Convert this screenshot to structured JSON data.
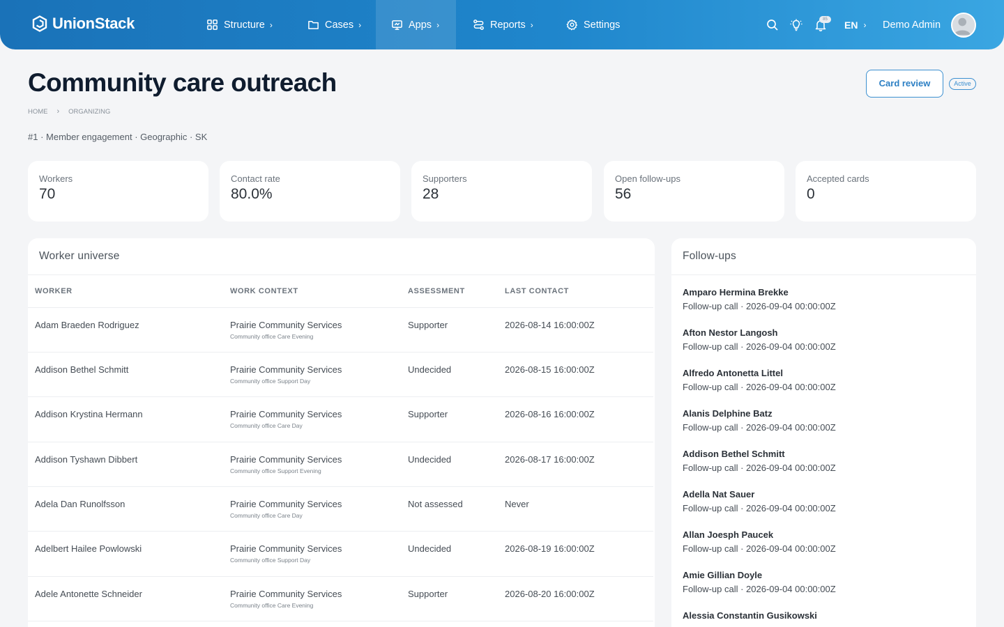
{
  "brand": {
    "name": "UnionStack"
  },
  "nav": {
    "items": [
      {
        "label": "Structure",
        "icon": "grid-icon"
      },
      {
        "label": "Cases",
        "icon": "folder-icon"
      },
      {
        "label": "Apps",
        "icon": "monitor-icon"
      },
      {
        "label": "Reports",
        "icon": "route-icon"
      },
      {
        "label": "Settings",
        "icon": "gear-icon"
      }
    ],
    "active": "Apps",
    "language": "EN",
    "notification_badge": "85",
    "user_name": "Demo Admin"
  },
  "header": {
    "title": "Community care outreach",
    "card_review_label": "Card review",
    "status": "Active",
    "breadcrumb": [
      "HOME",
      "ORGANIZING"
    ],
    "meta": "#1 · Member engagement · Geographic · SK"
  },
  "stats": [
    {
      "label": "Workers",
      "value": "70"
    },
    {
      "label": "Contact rate",
      "value": "80.0%"
    },
    {
      "label": "Supporters",
      "value": "28"
    },
    {
      "label": "Open follow-ups",
      "value": "56"
    },
    {
      "label": "Accepted cards",
      "value": "0"
    }
  ],
  "workers": {
    "title": "Worker universe",
    "columns": [
      "WORKER",
      "WORK CONTEXT",
      "ASSESSMENT",
      "LAST CONTACT"
    ],
    "rows": [
      {
        "worker": "Adam Braeden Rodriguez",
        "context": "Prairie Community Services",
        "sub": "Community office Care Evening",
        "assessment": "Supporter",
        "last_contact": "2026-08-14 16:00:00Z"
      },
      {
        "worker": "Addison Bethel Schmitt",
        "context": "Prairie Community Services",
        "sub": "Community office Support Day",
        "assessment": "Undecided",
        "last_contact": "2026-08-15 16:00:00Z"
      },
      {
        "worker": "Addison Krystina Hermann",
        "context": "Prairie Community Services",
        "sub": "Community office Care Day",
        "assessment": "Supporter",
        "last_contact": "2026-08-16 16:00:00Z"
      },
      {
        "worker": "Addison Tyshawn Dibbert",
        "context": "Prairie Community Services",
        "sub": "Community office Support Evening",
        "assessment": "Undecided",
        "last_contact": "2026-08-17 16:00:00Z"
      },
      {
        "worker": "Adela Dan Runolfsson",
        "context": "Prairie Community Services",
        "sub": "Community office Care Day",
        "assessment": "Not assessed",
        "last_contact": "Never"
      },
      {
        "worker": "Adelbert Hailee Powlowski",
        "context": "Prairie Community Services",
        "sub": "Community office Support Day",
        "assessment": "Undecided",
        "last_contact": "2026-08-19 16:00:00Z"
      },
      {
        "worker": "Adele Antonette Schneider",
        "context": "Prairie Community Services",
        "sub": "Community office Care Evening",
        "assessment": "Supporter",
        "last_contact": "2026-08-20 16:00:00Z"
      }
    ]
  },
  "followups": {
    "title": "Follow-ups",
    "items": [
      {
        "name": "Amparo Hermina Brekke",
        "detail": "Follow-up call · 2026-09-04 00:00:00Z"
      },
      {
        "name": "Afton Nestor Langosh",
        "detail": "Follow-up call · 2026-09-04 00:00:00Z"
      },
      {
        "name": "Alfredo Antonetta Littel",
        "detail": "Follow-up call · 2026-09-04 00:00:00Z"
      },
      {
        "name": "Alanis Delphine Batz",
        "detail": "Follow-up call · 2026-09-04 00:00:00Z"
      },
      {
        "name": "Addison Bethel Schmitt",
        "detail": "Follow-up call · 2026-09-04 00:00:00Z"
      },
      {
        "name": "Adella Nat Sauer",
        "detail": "Follow-up call · 2026-09-04 00:00:00Z"
      },
      {
        "name": "Allan Joesph Paucek",
        "detail": "Follow-up call · 2026-09-04 00:00:00Z"
      },
      {
        "name": "Amie Gillian Doyle",
        "detail": "Follow-up call · 2026-09-04 00:00:00Z"
      },
      {
        "name": "Alessia Constantin Gusikowski",
        "detail": ""
      }
    ]
  }
}
